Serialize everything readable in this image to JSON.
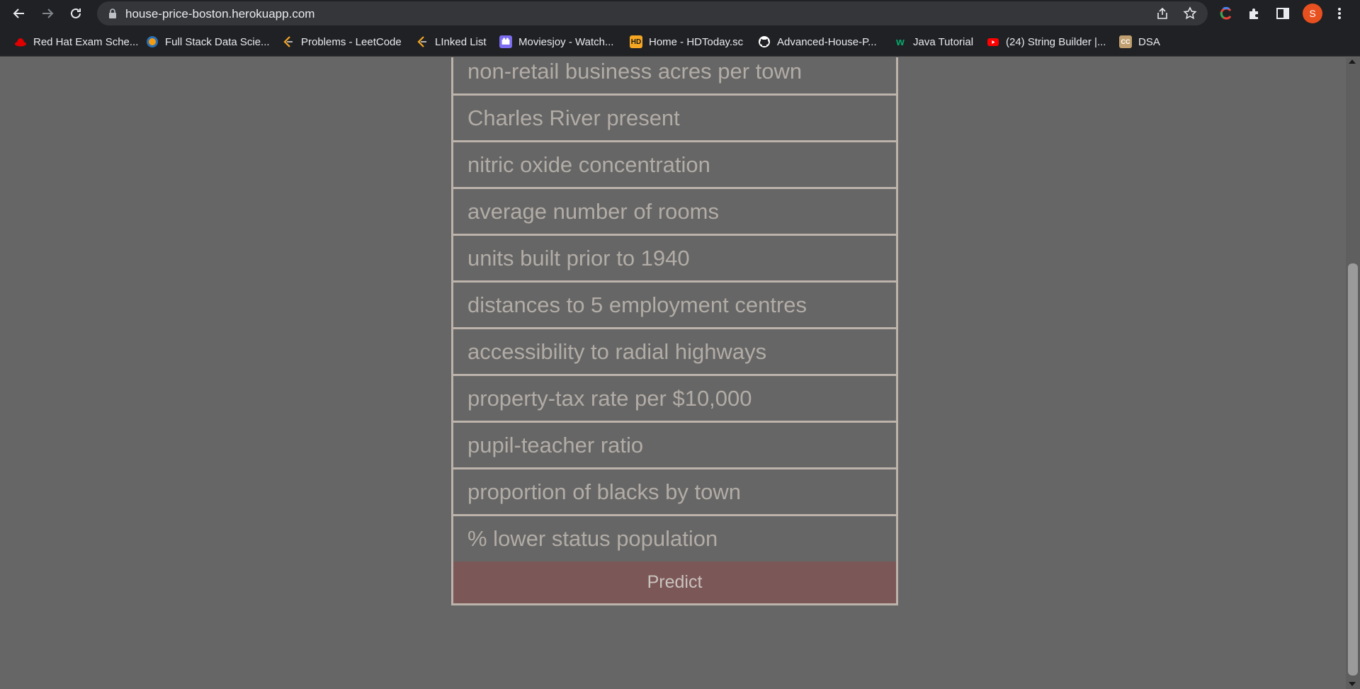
{
  "browser": {
    "url": "house-price-boston.herokuapp.com",
    "profile_initial": "S",
    "bookmarks": [
      {
        "label": "Red Hat Exam Sche...",
        "icon": "redhat-icon",
        "color": "#e00000"
      },
      {
        "label": "Full Stack Data Scie...",
        "icon": "globe-icon",
        "color": "#f39c12"
      },
      {
        "label": "Problems - LeetCode",
        "icon": "leetcode-icon",
        "color": "#f5a623"
      },
      {
        "label": "LInked List",
        "icon": "leetcode-icon",
        "color": "#f5a623"
      },
      {
        "label": "Moviesjoy - Watch...",
        "icon": "film-icon",
        "color": "#7b6cf0"
      },
      {
        "label": "Home - HDToday.sc",
        "icon": "hd-icon",
        "color": "#f5a623"
      },
      {
        "label": "Advanced-House-P...",
        "icon": "github-icon",
        "color": "#ffffff"
      },
      {
        "label": "Java Tutorial",
        "icon": "w3-icon",
        "color": "#04aa6d"
      },
      {
        "label": "(24) String Builder |...",
        "icon": "youtube-icon",
        "color": "#ff0000"
      },
      {
        "label": "DSA",
        "icon": "cc-icon",
        "color": "#c0a070"
      }
    ]
  },
  "form": {
    "fields": [
      "non-retail business acres per town",
      "Charles River present",
      "nitric oxide concentration",
      "average number of rooms",
      "units built prior to 1940",
      "distances to 5 employment centres",
      "accessibility to radial highways",
      "property-tax rate per $10,000",
      "pupil-teacher ratio",
      "proportion of blacks by town",
      "% lower status population"
    ],
    "submit_label": "Predict"
  }
}
